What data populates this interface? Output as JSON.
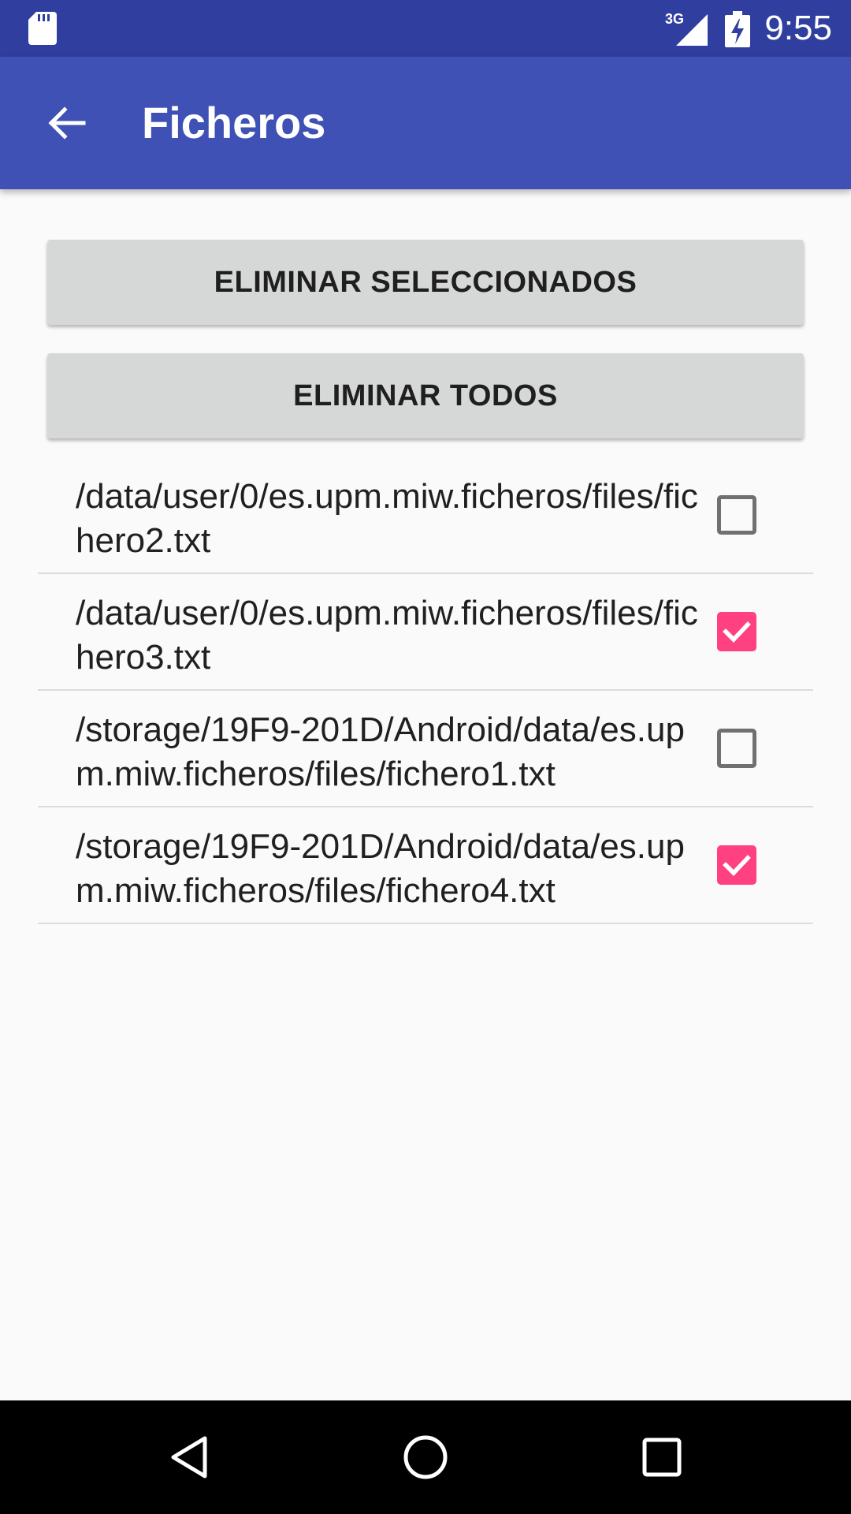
{
  "status_bar": {
    "time": "9:55",
    "network_label": "3G",
    "icons": [
      "sd-card-icon",
      "signal-icon",
      "battery-charging-icon"
    ]
  },
  "app_bar": {
    "title": "Ficheros",
    "back_icon": "arrow-back-icon"
  },
  "actions": {
    "delete_selected_label": "ELIMINAR SELECCIONADOS",
    "delete_all_label": "ELIMINAR TODOS"
  },
  "files": [
    {
      "path": "/data/user/0/es.upm.miw.ficheros/files/fichero2.txt",
      "checked": false
    },
    {
      "path": "/data/user/0/es.upm.miw.ficheros/files/fichero3.txt",
      "checked": true
    },
    {
      "path": "/storage/19F9-201D/Android/data/es.upm.miw.ficheros/files/fichero1.txt",
      "checked": false
    },
    {
      "path": "/storage/19F9-201D/Android/data/es.upm.miw.ficheros/files/fichero4.txt",
      "checked": true
    }
  ],
  "colors": {
    "status_bar": "#303f9f",
    "app_bar": "#3f51b5",
    "accent": "#ff4081",
    "background": "#fafafa",
    "button": "#d6d7d7"
  },
  "nav_bar": {
    "icons": [
      "nav-back-icon",
      "nav-home-icon",
      "nav-recent-apps-icon"
    ]
  }
}
